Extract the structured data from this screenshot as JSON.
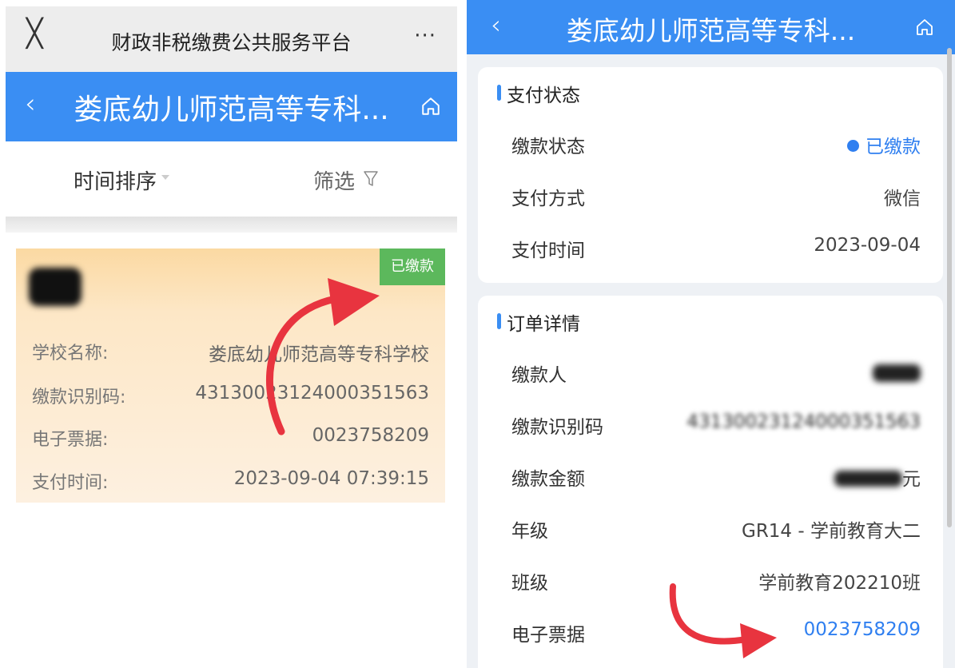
{
  "left": {
    "wechat_bar": {
      "close_icon": "close-icon",
      "title": "财政非税缴费公共服务平台",
      "more_label": "···"
    },
    "header": {
      "back_icon": "chevron-left-icon",
      "title": "娄底幼儿师范高等专科...",
      "home_icon": "home-icon"
    },
    "sort": {
      "time_label": "时间排序",
      "filter_label": "筛选"
    },
    "card": {
      "status": "已缴款",
      "rows": [
        {
          "label": "学校名称:",
          "value": "娄底幼儿师范高等专科学校"
        },
        {
          "label": "缴款识别码:",
          "value": "4313002312400035156​3"
        },
        {
          "label": "电子票据:",
          "value": "0023758209"
        },
        {
          "label": "支付时间:",
          "value": "2023-09-04 07:39:15"
        }
      ]
    }
  },
  "right": {
    "header": {
      "back_icon": "chevron-left-icon",
      "title": "娄底幼儿师范高等专科...",
      "home_icon": "home-icon"
    },
    "payment_status": {
      "heading": "支付状态",
      "rows": [
        {
          "label": "缴款状态",
          "value": "已缴款"
        },
        {
          "label": "支付方式",
          "value": "微信"
        },
        {
          "label": "支付时间",
          "value": "2023-09-04"
        }
      ]
    },
    "order_detail": {
      "heading": "订单详情",
      "rows": [
        {
          "label": "缴款人",
          "value": ""
        },
        {
          "label": "缴款识别码",
          "value": "43130023124000351563"
        },
        {
          "label": "缴款金额",
          "value": "元"
        },
        {
          "label": "年级",
          "value": "GR14 - 学前教育大二"
        },
        {
          "label": "班级",
          "value": "学前教育202210班"
        },
        {
          "label": "电子票据",
          "value": "0023758209"
        }
      ]
    }
  },
  "colors": {
    "brand_blue": "#3a8ef3",
    "link_blue": "#2f7ff0",
    "paid_green": "#5cb85c",
    "arrow_red": "#e8343f",
    "card_top": "#fbd9a2"
  }
}
